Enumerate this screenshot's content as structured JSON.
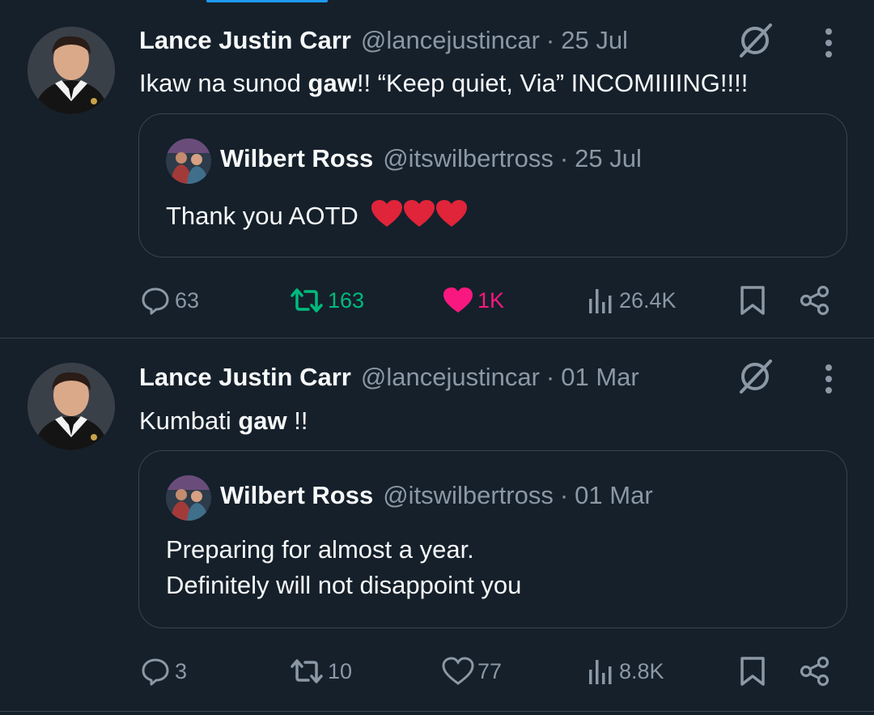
{
  "tweets": [
    {
      "author_name": "Lance Justin Carr",
      "handle": "@lancejustincar",
      "dot": "·",
      "date": "25 Jul",
      "text_before": "Ikaw na sunod ",
      "text_bold": "gaw",
      "text_after": "!! “Keep quiet, Via” INCOMIIIING!!!!",
      "quote": {
        "author_name": "Wilbert Ross",
        "handle": "@itswilbertross",
        "dot": "·",
        "date": "25 Jul",
        "text_line1": "Thank you AOTD",
        "text_line2": ""
      },
      "replies": "63",
      "retweets": "163",
      "likes": "1K",
      "views": "26.4K",
      "retweeted": true,
      "liked": true
    },
    {
      "author_name": "Lance Justin Carr",
      "handle": "@lancejustincar",
      "dot": "·",
      "date": "01 Mar",
      "text_before": "Kumbati ",
      "text_bold": "gaw",
      "text_after": " !!",
      "quote": {
        "author_name": "Wilbert Ross",
        "handle": "@itswilbertross",
        "dot": "·",
        "date": "01 Mar",
        "text_line1": "Preparing for almost a year.",
        "text_line2": "Definitely will not disappoint you"
      },
      "replies": "3",
      "retweets": "10",
      "likes": "77",
      "views": "8.8K",
      "retweeted": false,
      "liked": false
    }
  ],
  "icons": {
    "reply": "reply-icon",
    "retweet": "retweet-icon",
    "like": "heart-icon",
    "views": "views-icon",
    "bookmark": "bookmark-icon",
    "share": "share-icon",
    "grok": "grok-icon",
    "more": "more-options-icon"
  },
  "colors": {
    "background": "#15202b",
    "divider": "#38444d",
    "muted": "#8b98a5",
    "retweet_active": "#00ba7c",
    "like_active": "#f91880",
    "accent": "#1d9bf0"
  }
}
